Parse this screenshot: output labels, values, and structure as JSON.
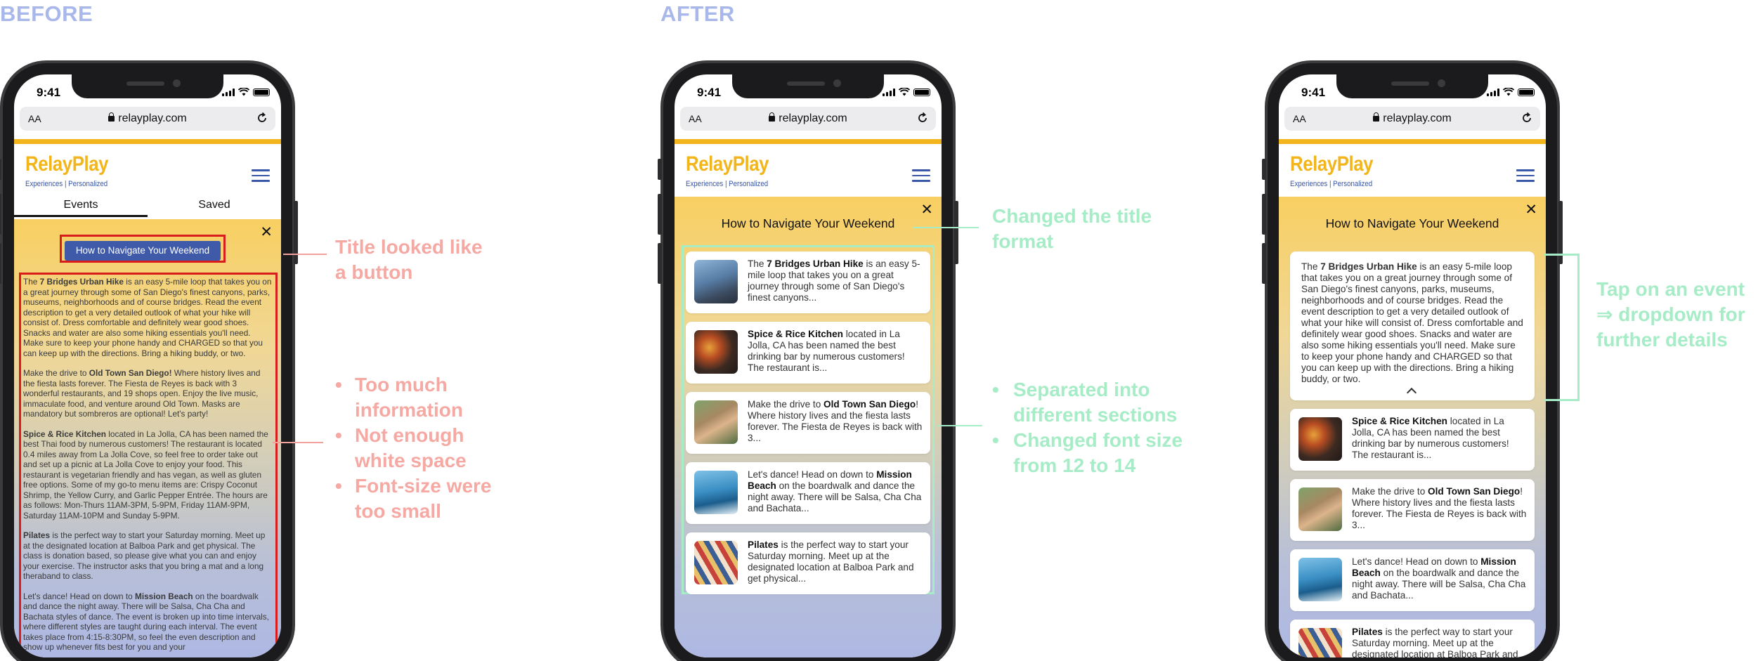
{
  "labels": {
    "before": "BEFORE",
    "after": "AFTER"
  },
  "phone": {
    "time": "9:41",
    "text_size": "AA",
    "url": "relayplay.com",
    "logo": "RelayPlay",
    "tagline": "Experiences | Personalized",
    "tab_events": "Events",
    "tab_saved": "Saved",
    "close": "✕"
  },
  "before": {
    "nav_button": "How to Navigate Your Weekend",
    "paragraphs": [
      [
        "",
        "The ",
        "7 Bridges Urban Hike",
        " is an easy 5-mile loop that takes you on a great journey through some of San Diego's finest canyons, parks, museums, neighborhoods and of course bridges. Read the event description to get a very detailed outlook of what your hike will consist of. Dress comfortable and definitely wear good shoes. Snacks and water are also some hiking essentials you'll need. Make sure to keep your phone handy and CHARGED so that you can keep up with the directions. Bring a hiking buddy, or two."
      ],
      [
        "",
        "Make the drive to ",
        "Old Town San Diego!",
        " Where history lives and the fiesta lasts forever. The Fiesta de Reyes is back with 3 wonderful restaurants, and 19 shops open. Enjoy the live music, immaculate food, and venture around Old Town. Masks are mandatory but sombreros are optional! Let's party!"
      ],
      [
        "",
        "",
        "Spice & Rice Kitchen",
        " located in La Jolla, CA has been named the best Thai food by numerous customers! The restaurant is located 0.4 miles away from La Jolla Cove, so feel free to order take out and set up a picnic at La Jolla Cove to enjoy your food. This restaurant is vegetarian friendly and has vegan, as well as gluten free options. Some of my go-to menu items are: Crispy Coconut Shrimp, the Yellow Curry, and Garlic Pepper Entrée. The hours are as follows: Mon-Thurs 11AM-3PM, 5-9PM, Friday 11AM-9PM, Saturday 11AM-10PM and Sunday 5-9PM."
      ],
      [
        "",
        "",
        "Pilates",
        " is the perfect way to start your Saturday morning. Meet up at the designated location at Balboa Park and get physical. The class is donation based, so please give what you can and enjoy your exercise. The instructor asks that you bring a mat and a long theraband to class."
      ],
      [
        "",
        "Let's dance! Head on down to ",
        "Mission Beach",
        " on the boardwalk and dance the night away. There will be Salsa, Cha Cha and Bachata styles of dance. The event is broken up into time intervals, where different styles are taught during each interval. The event takes place from 4:15-8:30PM, so feel the even description and show up whenever fits best for you and your"
      ]
    ],
    "notes": {
      "title": "Title looked like a button",
      "bullets": [
        "Too much information",
        "Not enough white space",
        "Font-size were too small"
      ]
    }
  },
  "after1": {
    "title": "How to Navigate Your Weekend",
    "cards": [
      {
        "thumb": "hiking-photo",
        "pre": "The ",
        "bold": "7 Bridges Urban Hike",
        "post": " is an easy 5-mile loop that takes you on a great journey through some of San Diego's finest canyons..."
      },
      {
        "thumb": "food-photo",
        "pre": "",
        "bold": "Spice & Rice Kitchen",
        "post": " located in La Jolla, CA has been named the best drinking bar by numerous customers! The restaurant is..."
      },
      {
        "thumb": "old-town-photo",
        "pre": "Make the drive to ",
        "bold": "Old Town San Diego",
        "post": "! Where history lives and the fiesta lasts forever. The Fiesta de Reyes is back with 3..."
      },
      {
        "thumb": "beach-photo",
        "pre": "Let's dance! Head on down to ",
        "bold": "Mission Beach",
        "post": " on the boardwalk and dance the night away. There will be Salsa, Cha Cha and Bachata..."
      },
      {
        "thumb": "pilates-photo",
        "pre": "",
        "bold": "Pilates",
        "post": " is the perfect way to start your Saturday morning. Meet up at the designated location at Balboa Park and get physical..."
      }
    ],
    "notes": {
      "title": "Changed the title format",
      "bullets": [
        "Separated into different sections",
        "Changed font size from 12 to 14"
      ]
    }
  },
  "after2": {
    "title": "How to Navigate Your Weekend",
    "expanded": {
      "pre": "The ",
      "bold": "7 Bridges Urban Hike",
      "post": " is an easy 5-mile loop that takes you on a great journey through some of San Diego's finest canyons, parks, museums, neighborhoods and of course bridges. Read the event description to get a very detailed outlook of what your hike will consist of. Dress comfortable and definitely wear good shoes. Snacks and water are also some hiking essentials you'll need. Make sure to keep your phone handy and CHARGED so that you can keep up with the directions. Bring a hiking buddy, or two."
    },
    "cards": [
      {
        "thumb": "food-photo",
        "pre": "",
        "bold": "Spice & Rice Kitchen",
        "post": " located in La Jolla, CA has been named the best drinking bar by numerous customers! The restaurant is..."
      },
      {
        "thumb": "old-town-photo",
        "pre": "Make the drive to ",
        "bold": "Old Town San Diego",
        "post": "! Where history lives and the fiesta lasts forever. The Fiesta de Reyes is back with 3..."
      },
      {
        "thumb": "beach-photo",
        "pre": "Let's dance! Head on down to ",
        "bold": "Mission Beach",
        "post": " on the boardwalk and dance the night away. There will be Salsa, Cha Cha and Bachata..."
      },
      {
        "thumb": "pilates-photo",
        "pre": "",
        "bold": "Pilates",
        "post": " is the perfect way to start your Saturday morning. Meet up at the designated location at Balboa Park and get physical..."
      }
    ],
    "notes": {
      "text": "Tap on an event ⇒ dropdown for further details"
    }
  },
  "colors": {
    "brand_yellow": "#f2b51b",
    "brand_blue": "#3e5aa9",
    "annotation_red": "#f6a8a3",
    "annotation_green": "#a6ecc6",
    "label_blue": "#a9b8ea"
  }
}
